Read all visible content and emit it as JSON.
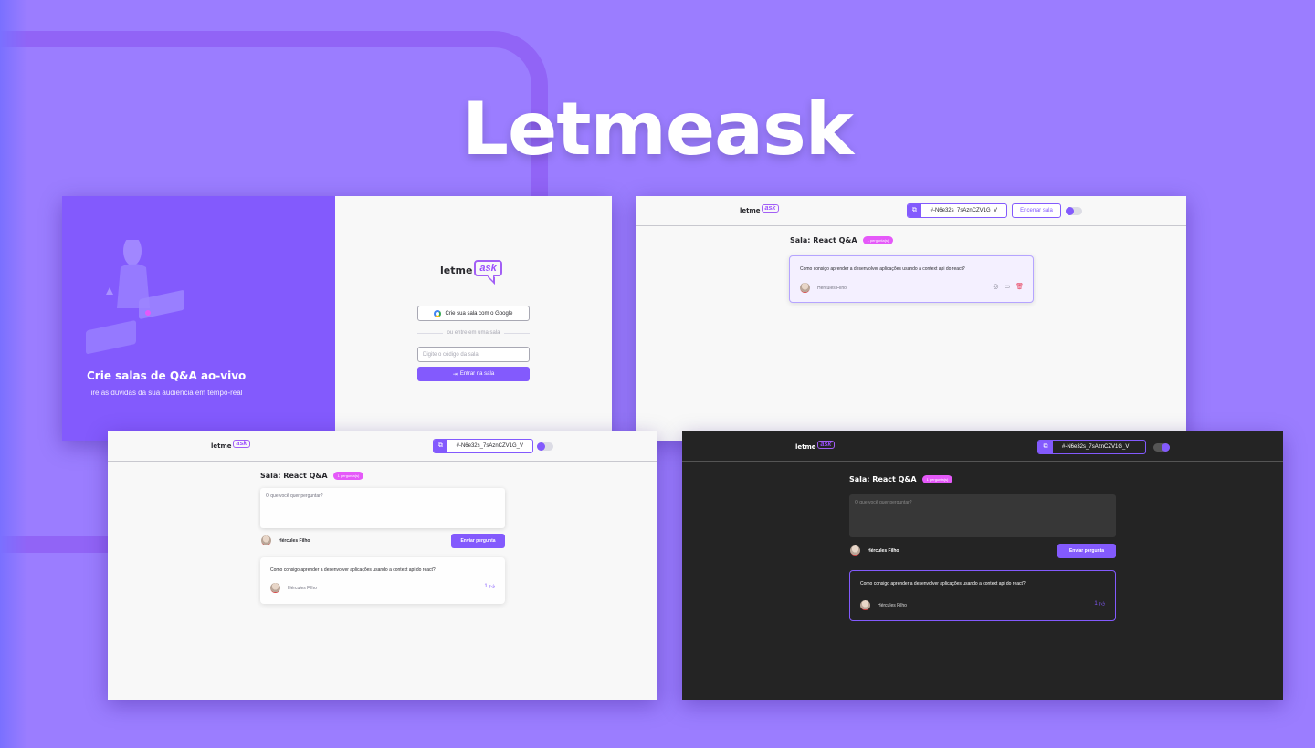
{
  "hero": {
    "title": "Letmeask"
  },
  "logo": {
    "letme": "letme",
    "ask": "ask"
  },
  "login": {
    "aside_title": "Crie salas de Q&A ao-vivo",
    "aside_subtitle": "Tire as dúvidas da sua audiência em tempo-real",
    "google_button": "Crie sua sala com o Google",
    "separator": "ou entre em uma sala",
    "code_placeholder": "Digite o código da sala",
    "enter_button": "Entrar na sala"
  },
  "room": {
    "code": "#-N6e32s_7sAznCZV1G_V",
    "close_button": "Encerrar sala",
    "title": "Sala: React Q&A",
    "badge": "1 pergunta(s)",
    "ask_placeholder": "O que você quer perguntar?",
    "user_name": "Hércules Filho",
    "send_button": "Enviar pergunta",
    "question": {
      "content": "Como consigo aprender a desenvolver aplicações usando a context api do react?",
      "author": "Hércules Filho",
      "likes": "1"
    }
  },
  "icons": {
    "copy": "copy-icon",
    "check": "check-circle-icon",
    "answer": "message-icon",
    "delete": "trash-icon",
    "like": "thumbs-up-icon",
    "login": "login-icon",
    "google": "google-icon"
  },
  "colors": {
    "background": "#9b7dff",
    "primary": "#835afd",
    "pink": "#e559f9",
    "dark_bg": "#242424",
    "danger": "#e73f5d"
  }
}
